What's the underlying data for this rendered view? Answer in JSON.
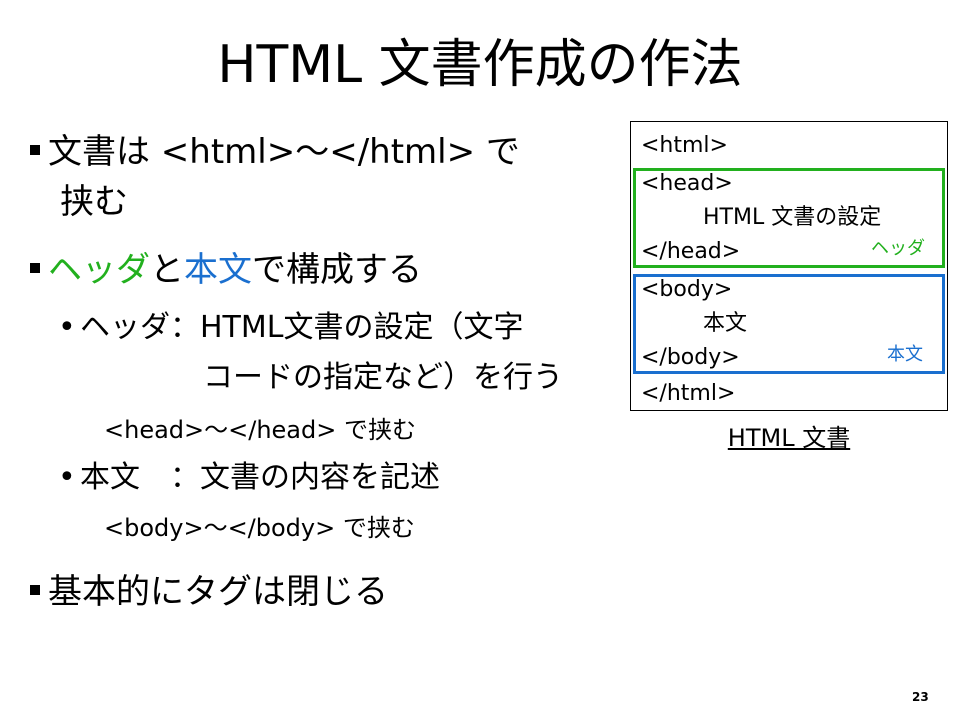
{
  "slide": {
    "title": "HTML 文書作成の作法",
    "page_number": "23",
    "bullets": {
      "b1_line1": "文書は <html>～</html> で",
      "b1_line2": "挟む",
      "b2_part1": "ヘッダ",
      "b2_part2": "と",
      "b2_part3": "本文",
      "b2_part4": "で構成する",
      "sub1_label": "ヘッダ：",
      "sub1_line1": "HTML文書の設定（文字",
      "sub1_line2": "コードの指定など）を行う",
      "sub1_note": "<head>～</head> で挟む",
      "sub2_label": "本文　：",
      "sub2_line1": "文書の内容を記述",
      "sub2_note": "<body>～</body> で挟む",
      "b3_text": "基本的にタグは閉じる"
    },
    "diagram": {
      "html_open": "<html>",
      "head_open": "<head>",
      "head_content": "HTML 文書の設定",
      "head_close": "</head>",
      "head_label": "ヘッダ",
      "body_open": "<body>",
      "body_content": "本文",
      "body_close": "</body>",
      "body_label": "本文",
      "html_close": "</html>",
      "caption": "HTML 文書"
    },
    "colors": {
      "head_box": "#22b01e",
      "body_box": "#1a6fcf"
    }
  }
}
